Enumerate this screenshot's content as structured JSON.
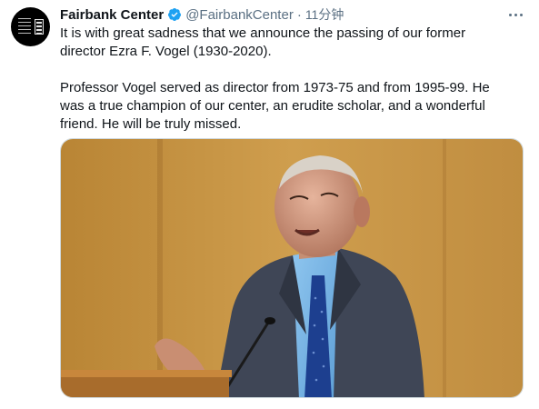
{
  "tweet": {
    "author_name": "Fairbank Center",
    "handle": "@FairbankCenter",
    "separator": "·",
    "time": "11分钟",
    "paragraphs": [
      "It is with great sadness that we announce the passing of our former director Ezra F. Vogel (1930-2020).",
      "Professor Vogel served as director from 1973-75 and from 1995-99. He was a true champion of our center, an erudite scholar, and a wonderful friend. He will be truly missed."
    ],
    "verified": true
  },
  "icons": {
    "verified": "verified-badge-icon",
    "more": "more-options-icon"
  },
  "colors": {
    "verified_blue": "#1da1f2",
    "secondary_text": "#5b7083",
    "wall": "#c89a4a"
  }
}
